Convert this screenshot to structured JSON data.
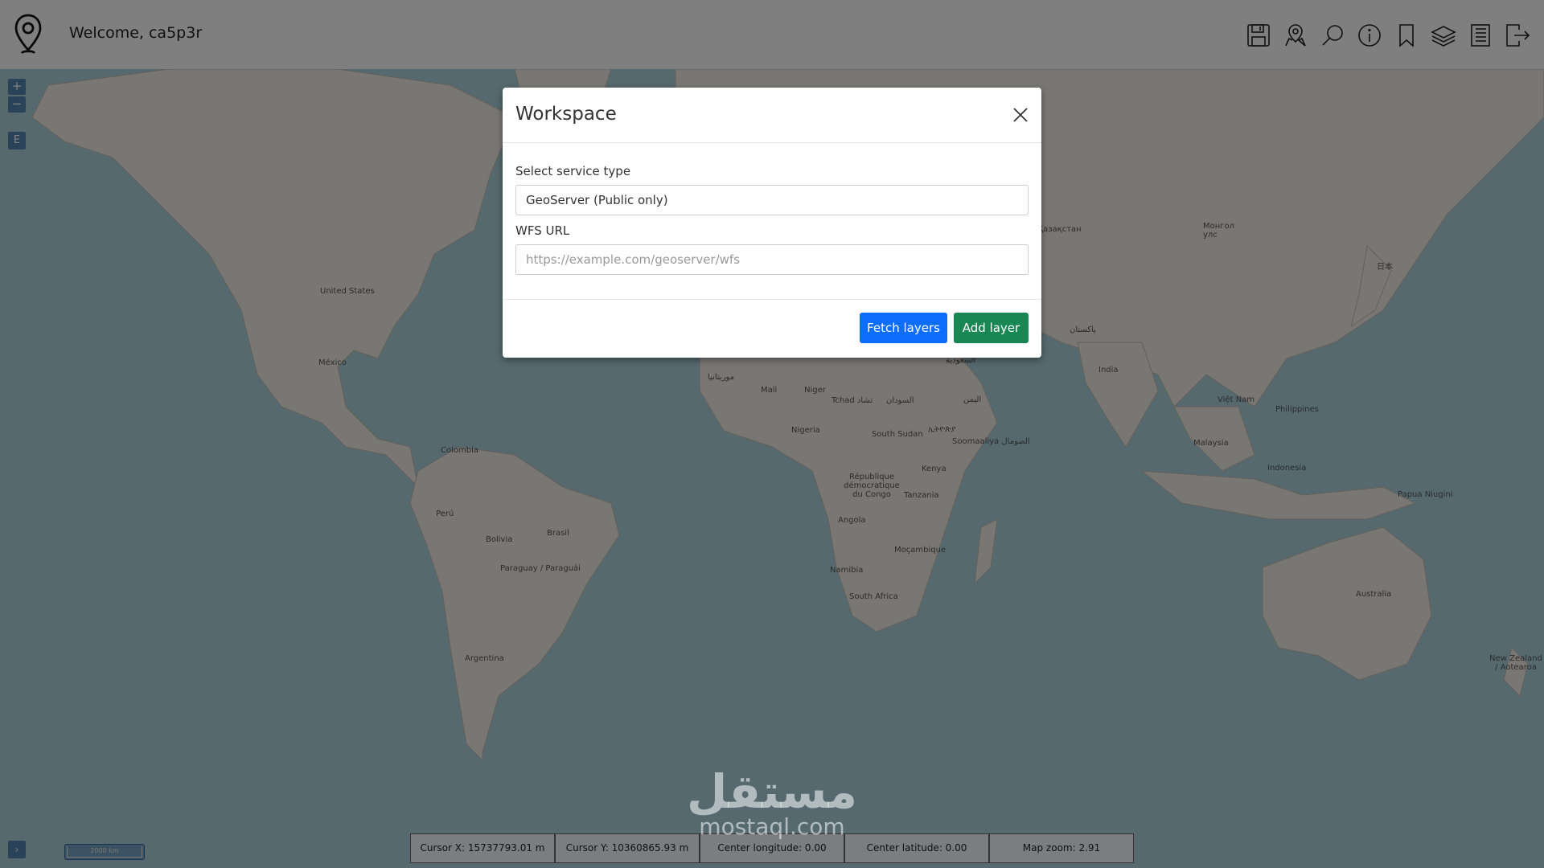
{
  "header": {
    "welcome_text": "Welcome, ca5p3r",
    "logo_icon": "map-pin-icon",
    "toolbar": [
      {
        "name": "save-icon",
        "label": "Save"
      },
      {
        "name": "user-location-icon",
        "label": "Location"
      },
      {
        "name": "search-icon",
        "label": "Search"
      },
      {
        "name": "info-icon",
        "label": "Info"
      },
      {
        "name": "bookmark-icon",
        "label": "Bookmark"
      },
      {
        "name": "layers-icon",
        "label": "Layers"
      },
      {
        "name": "list-icon",
        "label": "List"
      },
      {
        "name": "logout-icon",
        "label": "Logout"
      }
    ]
  },
  "map_controls": {
    "zoom_in": "+",
    "zoom_out": "−",
    "extent_button": "E",
    "expand_button": "›",
    "scale_label": "2000 km"
  },
  "map_labels": [
    "United States",
    "México",
    "Colombia",
    "Perú",
    "Brasil",
    "Bolivia",
    "Paraguay / Paraguái",
    "Argentina",
    "Mali",
    "Niger",
    "Tchad تشاد",
    "السودان",
    "Nigeria",
    "South Sudan",
    "ኢትዮጵያ",
    "Soomaaliya الصومال",
    "Kenya",
    "République démocratique du Congo",
    "Tanzania",
    "Angola",
    "Moçambique",
    "Namibia",
    "South Africa",
    "India",
    "Việt Nam",
    "Philippines",
    "Malaysia",
    "Indonesia",
    "Papua Niugini",
    "Australia",
    "New Zealand / Aotearoa",
    "Монгол улс",
    "Қазақстан",
    "پاکستان",
    "日本",
    "السعودية",
    "اليمن",
    "موريتانيا"
  ],
  "modal": {
    "title": "Workspace",
    "service_type_label": "Select service type",
    "service_type_value": "GeoServer (Public only)",
    "wfs_url_label": "WFS URL",
    "wfs_url_placeholder": "https://example.com/geoserver/wfs",
    "fetch_button": "Fetch layers",
    "add_button": "Add layer"
  },
  "status_bar": [
    "Cursor X: 15737793.01 m",
    "Cursor Y: 10360865.93 m",
    "Center longitude: 0.00",
    "Center latitude: 0.00",
    "Map zoom: 2.91"
  ],
  "watermark": {
    "arabic": "مستقل",
    "latin": "mostaql.com"
  },
  "colors": {
    "fetch_button": "#0d6efd",
    "add_button": "#198754",
    "ocean": "#aad3df",
    "land": "#f2efe9"
  }
}
